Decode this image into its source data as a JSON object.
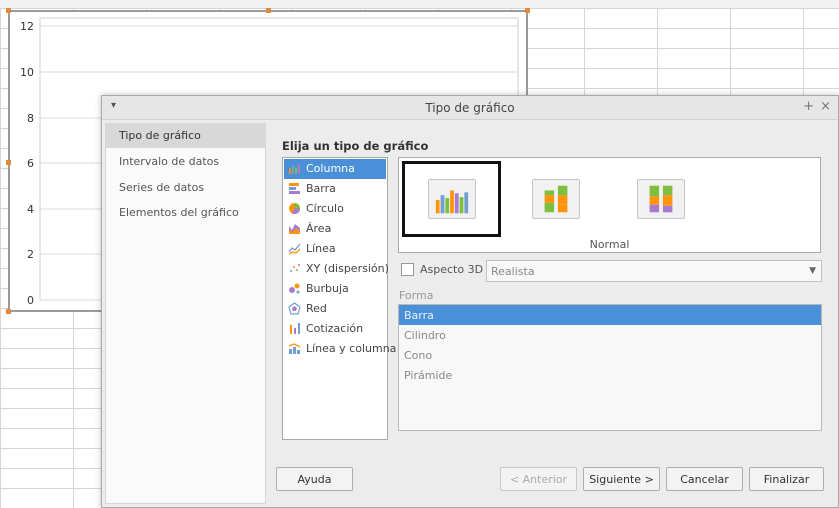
{
  "chart": {
    "y_ticks": [
      "12",
      "10",
      "8",
      "6",
      "4",
      "2",
      "0"
    ]
  },
  "dialog": {
    "title": "Tipo de gráfico",
    "menu_glyph": "▾",
    "pin_glyph": "+",
    "close_glyph": "×",
    "sidebar": [
      {
        "label": "Tipo de gráfico"
      },
      {
        "label": "Intervalo de datos"
      },
      {
        "label": "Series de datos"
      },
      {
        "label": "Elementos del gráfico"
      }
    ],
    "heading": "Elija un tipo de gráfico",
    "chart_types": [
      {
        "label": "Columna",
        "icon": "column-chart-icon"
      },
      {
        "label": "Barra",
        "icon": "bar-chart-icon"
      },
      {
        "label": "Círculo",
        "icon": "pie-chart-icon"
      },
      {
        "label": "Área",
        "icon": "area-chart-icon"
      },
      {
        "label": "Línea",
        "icon": "line-chart-icon"
      },
      {
        "label": "XY (dispersión)",
        "icon": "scatter-chart-icon"
      },
      {
        "label": "Burbuja",
        "icon": "bubble-chart-icon"
      },
      {
        "label": "Red",
        "icon": "net-chart-icon"
      },
      {
        "label": "Cotización",
        "icon": "stock-chart-icon"
      },
      {
        "label": "Línea y columna",
        "icon": "column-line-chart-icon"
      }
    ],
    "variant_label": "Normal",
    "aspect3d_label": "Aspecto 3D",
    "aspect3d_value": "Realista",
    "form_label": "Forma",
    "shapes": [
      "Barra",
      "Cilindro",
      "Cono",
      "Pirámide"
    ],
    "buttons": {
      "help": "Ayuda",
      "back": "< Anterior",
      "next": "Siguiente >",
      "cancel": "Cancelar",
      "finish": "Finalizar"
    },
    "colors": {
      "selection": "#4a90d9",
      "series1": "#729fcf",
      "series2": "#ff950e",
      "series3": "#7fbf3f",
      "series4": "#a77bd0"
    }
  }
}
